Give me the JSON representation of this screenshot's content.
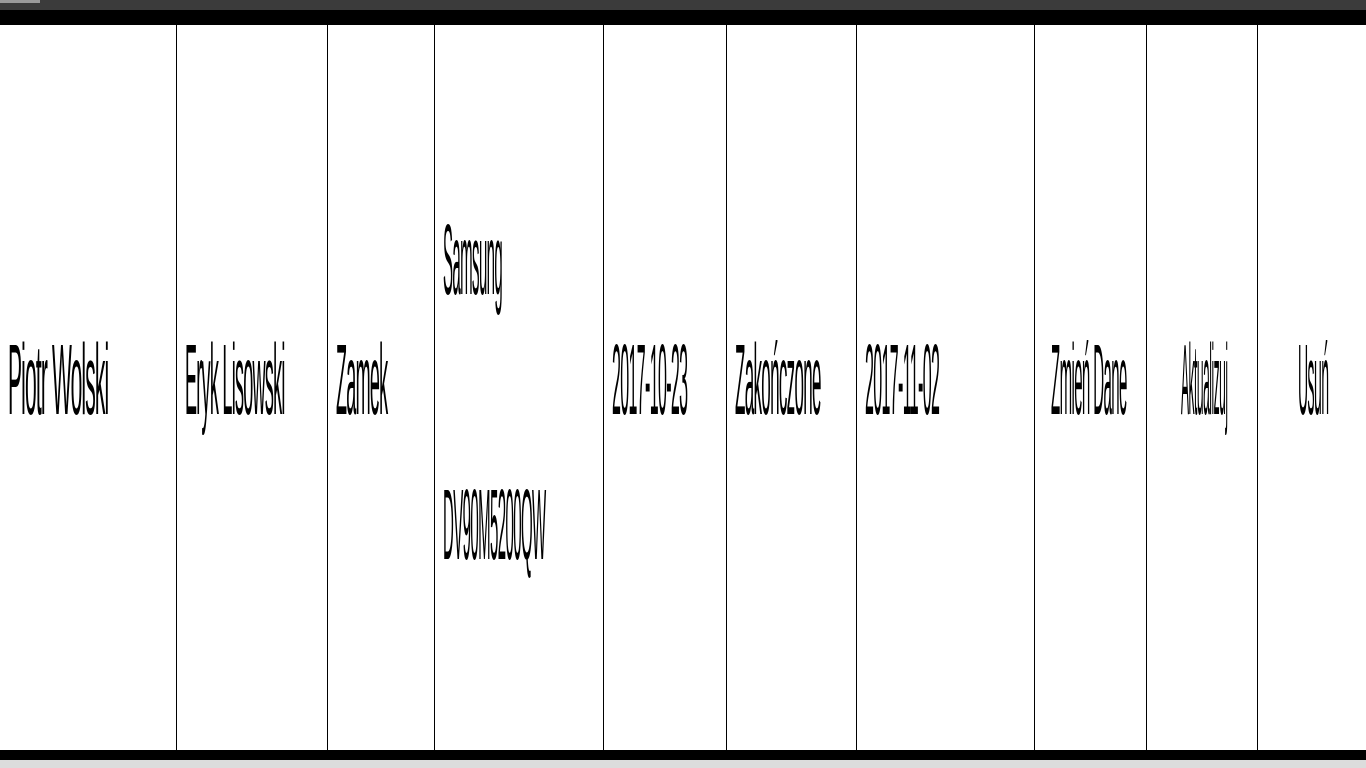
{
  "row": {
    "employee": "Piotr Wolski",
    "client": "Eryk Lisowski",
    "type": "Zamek",
    "device_brand": "Samsung",
    "device_serial": "DV90M5200QW",
    "date_received": "2017-10-23",
    "status": "Zakończone",
    "date_completed": "2017-11-02",
    "action_edit": "Zmień Dane",
    "action_update": "Aktualizuj",
    "action_delete": "Usuń"
  }
}
